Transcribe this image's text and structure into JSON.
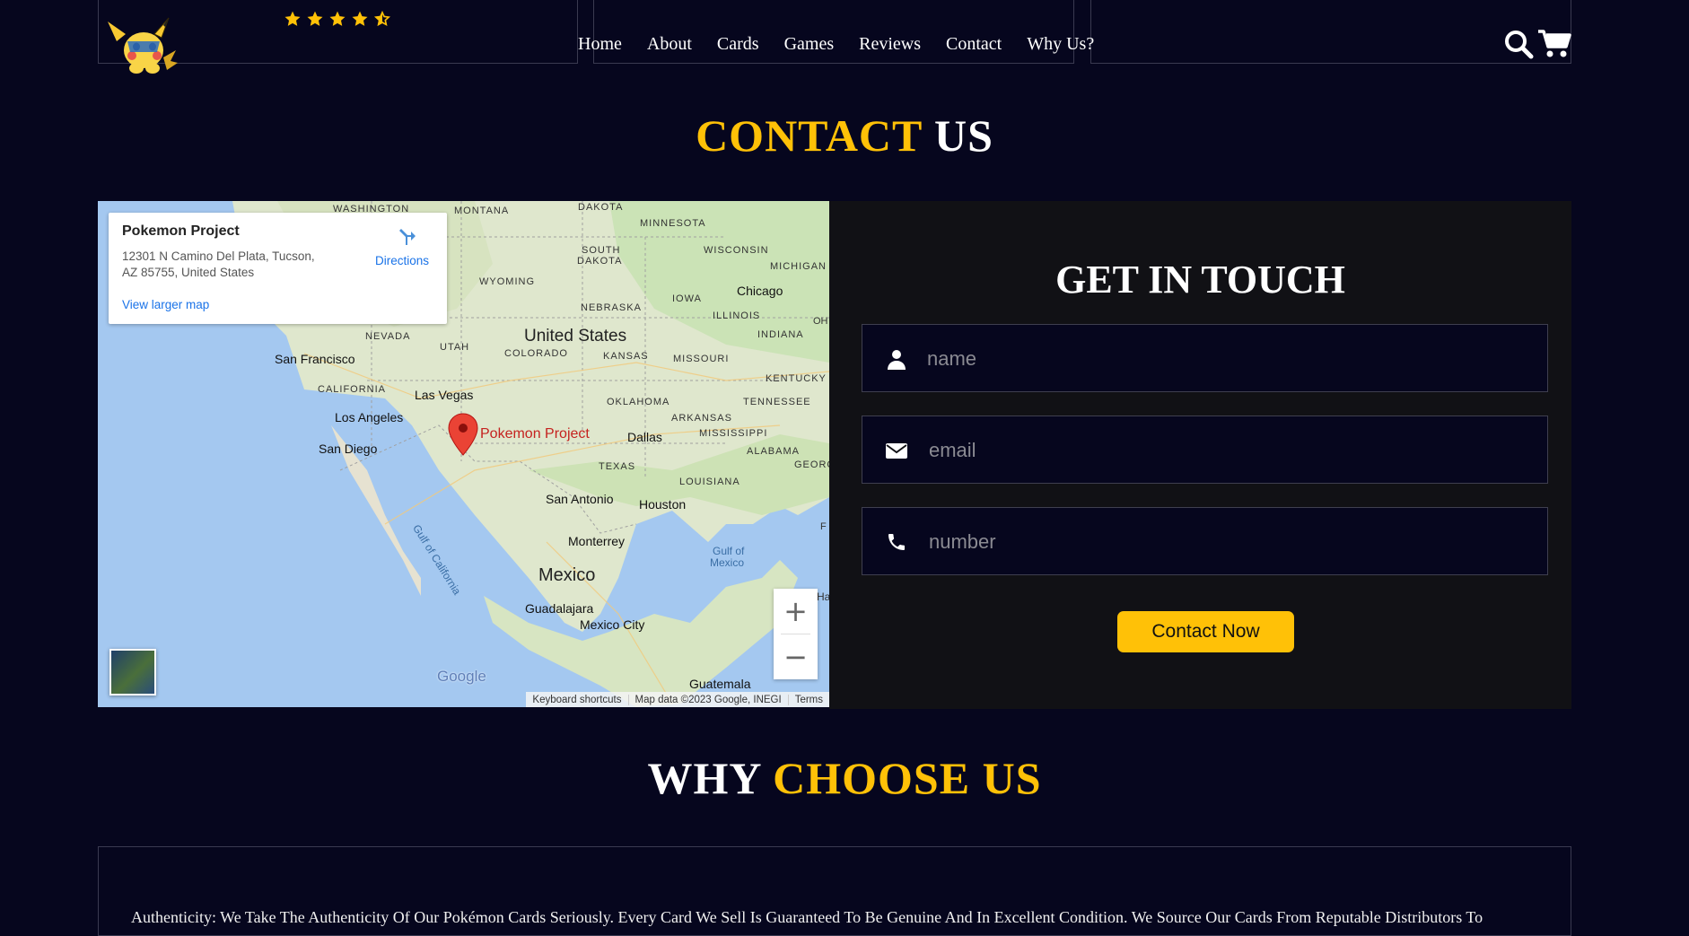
{
  "header": {
    "rating_stars": 4.5,
    "nav": [
      "Home",
      "About",
      "Cards",
      "Games",
      "Reviews",
      "Contact",
      "Why Us?"
    ]
  },
  "contact": {
    "title_highlight": "CONTACT",
    "title_rest": "US"
  },
  "map": {
    "place_name": "Pokemon Project",
    "address_line1": "12301 N Camino Del Plata, Tucson,",
    "address_line2": "AZ 85755, United States",
    "directions_label": "Directions",
    "larger_map_link": "View larger map",
    "marker_label": "Pokemon Project",
    "labels": {
      "washington": "WASHINGTON",
      "montana": "MONTANA",
      "north_dakota": "DAKOTA",
      "minnesota": "MINNESOTA",
      "south_dakota_1": "SOUTH",
      "south_dakota_2": "DAKOTA",
      "wisconsin": "WISCONSIN",
      "michigan": "MICHIGAN",
      "wyoming": "WYOMING",
      "chicago": "Chicago",
      "iowa": "IOWA",
      "nebraska": "NEBRASKA",
      "illinois": "ILLINOIS",
      "oh": "OH",
      "united_states": "United States",
      "nevada": "NEVADA",
      "utah": "UTAH",
      "colorado": "COLORADO",
      "kansas": "KANSAS",
      "missouri": "MISSOURI",
      "indiana": "INDIANA",
      "san_francisco": "San Francisco",
      "kentucky": "KENTUCKY",
      "california": "CALIFORNIA",
      "las_vegas": "Las Vegas",
      "oklahoma": "OKLAHOMA",
      "tennessee": "TENNESSEE",
      "los_angeles": "Los Angeles",
      "arkansas": "ARKANSAS",
      "mississippi": "MISSISSIPPI",
      "alabama": "ALABAMA",
      "san_diego": "San Diego",
      "dallas": "Dallas",
      "georgia": "GEORC",
      "texas": "TEXAS",
      "louisiana": "LOUISIANA",
      "gulf_california": "Gulf of California",
      "san_antonio": "San Antonio",
      "houston": "Houston",
      "fl": "F",
      "monterrey": "Monterrey",
      "gulf_mexico_1": "Gulf of",
      "gulf_mexico_2": "Mexico",
      "mexico": "Mexico",
      "guadalajara": "Guadalajara",
      "mexico_city": "Mexico City",
      "guatemala": "Guatemala",
      "hav": "Hav"
    },
    "google_logo": "Google",
    "zoom_in": "+",
    "zoom_out": "−",
    "footer": {
      "shortcuts": "Keyboard shortcuts",
      "data": "Map data ©2023 Google, INEGI",
      "terms": "Terms"
    }
  },
  "form": {
    "title": "GET IN TOUCH",
    "name_placeholder": "name",
    "email_placeholder": "email",
    "number_placeholder": "number",
    "submit_label": "Contact Now",
    "icons": [
      "user-icon",
      "envelope-icon",
      "phone-icon"
    ]
  },
  "why": {
    "title_rest": "WHY",
    "title_highlight": "CHOOSE US",
    "text": "Authenticity: We Take The Authenticity Of Our Pokémon Cards Seriously. Every Card We Sell Is Guaranteed To Be Genuine And In Excellent Condition. We Source Our Cards From Reputable Distributors To"
  },
  "colors": {
    "background": "#06061e",
    "accent": "#ffc107",
    "panel": "#111115"
  }
}
